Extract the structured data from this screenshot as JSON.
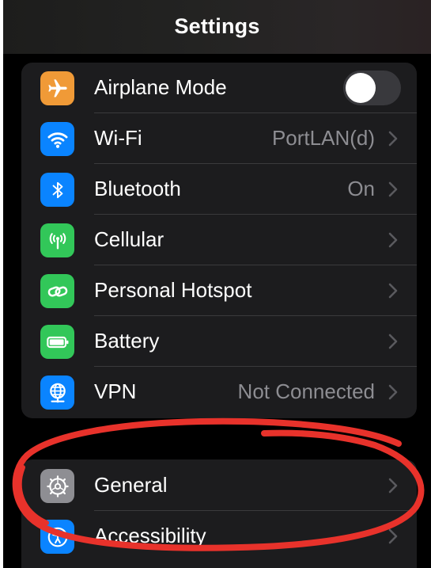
{
  "navbar": {
    "title": "Settings"
  },
  "group1": {
    "rows": [
      {
        "label": "Airplane Mode",
        "icon": "airplane-icon",
        "icon_color": "#f09a37",
        "control": "toggle",
        "toggle_on": false
      },
      {
        "label": "Wi-Fi",
        "value": "PortLAN(d)",
        "icon": "wifi-icon",
        "icon_color": "#0a84ff"
      },
      {
        "label": "Bluetooth",
        "value": "On",
        "icon": "bluetooth-icon",
        "icon_color": "#0a84ff"
      },
      {
        "label": "Cellular",
        "icon": "antenna-icon",
        "icon_color": "#32c759"
      },
      {
        "label": "Personal Hotspot",
        "icon": "hotspot-link-icon",
        "icon_color": "#32c759"
      },
      {
        "label": "Battery",
        "icon": "battery-icon",
        "icon_color": "#32c759"
      },
      {
        "label": "VPN",
        "value": "Not Connected",
        "icon": "globe-network-icon",
        "icon_color": "#0a84ff"
      }
    ]
  },
  "group2": {
    "rows": [
      {
        "label": "General",
        "icon": "gear-icon",
        "icon_color": "#8e8e93"
      },
      {
        "label": "Accessibility",
        "icon": "accessibility-icon",
        "icon_color": "#0a84ff"
      }
    ]
  },
  "annotation": {
    "color": "#e8322b",
    "shape": "hand-drawn circle around General"
  }
}
